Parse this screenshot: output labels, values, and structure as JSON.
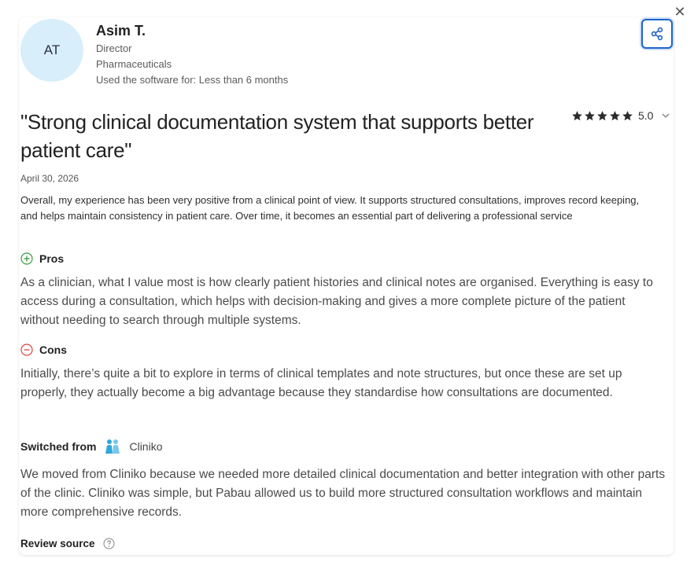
{
  "reviewer": {
    "initials": "AT",
    "name": "Asim T.",
    "role": "Director",
    "industry": "Pharmaceuticals",
    "usage": "Used the software for: Less than 6 months"
  },
  "review": {
    "title": "\"Strong clinical documentation system that supports better patient care\"",
    "rating": "5.0",
    "stars": 5,
    "date": "April 30, 2026",
    "summary": "Overall, my experience has been very positive from a clinical point of view. It supports structured consultations, improves record keeping, and helps maintain consistency in patient care. Over time, it becomes an essential part of delivering a professional service",
    "pros_label": "Pros",
    "pros": "As a clinician, what I value most is how clearly patient histories and clinical notes are organised. Everything is easy to access during a consultation, which helps with decision-making and gives a more complete picture of the patient without needing to search through multiple systems.",
    "cons_label": "Cons",
    "cons": "Initially, there’s quite a bit to explore in terms of clinical templates and note structures, but once these are set up properly, they actually become a big advantage because they standardise how consultations are documented.",
    "switched_label": "Switched from",
    "switched_product": "Cliniko",
    "switched_reason": "We moved from Cliniko because we needed more detailed clinical documentation and better integration with other parts of the clinic. Cliniko was simple, but Pabau allowed us to build more structured consultation workflows and maintain more comprehensive records.",
    "source_label": "Review source"
  },
  "icons": {
    "close": "close-icon",
    "share": "share-icon",
    "star": "star-icon",
    "chevron": "chevron-down-icon",
    "pros": "plus-circle-icon",
    "cons": "minus-circle-icon",
    "help": "question-circle-icon"
  },
  "colors": {
    "accent": "#1f64c8",
    "pros": "#3a9a45",
    "cons": "#d9463b",
    "avatar_bg": "#d8eefa"
  }
}
